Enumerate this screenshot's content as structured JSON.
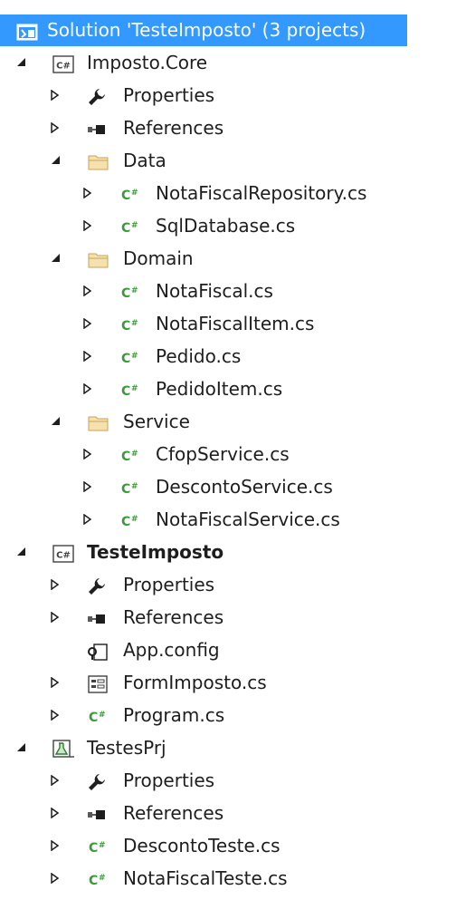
{
  "solution": {
    "label": "Solution 'TesteImposto' (3 projects)",
    "icon": "solution-icon"
  },
  "items": [
    {
      "name": "project-imposto-core",
      "label": "Imposto.Core",
      "level": 1,
      "icon": "csharp-project-icon",
      "expander": "expanded",
      "bold": false
    },
    {
      "name": "item-properties",
      "label": "Properties",
      "level": 2,
      "icon": "wrench-icon",
      "expander": "collapsed",
      "bold": false
    },
    {
      "name": "item-references",
      "label": "References",
      "level": 2,
      "icon": "references-icon",
      "expander": "collapsed",
      "bold": false
    },
    {
      "name": "folder-data",
      "label": "Data",
      "level": 2,
      "icon": "folder-icon",
      "expander": "expanded",
      "bold": false
    },
    {
      "name": "file-notafiscalrepository",
      "label": "NotaFiscalRepository.cs",
      "level": 3,
      "icon": "csharp-file-icon",
      "expander": "collapsed",
      "bold": false
    },
    {
      "name": "file-sqldatabase",
      "label": "SqlDatabase.cs",
      "level": 3,
      "icon": "csharp-file-icon",
      "expander": "collapsed",
      "bold": false
    },
    {
      "name": "folder-domain",
      "label": "Domain",
      "level": 2,
      "icon": "folder-icon",
      "expander": "expanded",
      "bold": false
    },
    {
      "name": "file-notafiscal",
      "label": "NotaFiscal.cs",
      "level": 3,
      "icon": "csharp-file-icon",
      "expander": "collapsed",
      "bold": false
    },
    {
      "name": "file-notafiscalitem",
      "label": "NotaFiscalItem.cs",
      "level": 3,
      "icon": "csharp-file-icon",
      "expander": "collapsed",
      "bold": false
    },
    {
      "name": "file-pedido",
      "label": "Pedido.cs",
      "level": 3,
      "icon": "csharp-file-icon",
      "expander": "collapsed",
      "bold": false
    },
    {
      "name": "file-pedidoitem",
      "label": "PedidoItem.cs",
      "level": 3,
      "icon": "csharp-file-icon",
      "expander": "collapsed",
      "bold": false
    },
    {
      "name": "folder-service",
      "label": "Service",
      "level": 2,
      "icon": "folder-icon",
      "expander": "expanded",
      "bold": false
    },
    {
      "name": "file-cfopservice",
      "label": "CfopService.cs",
      "level": 3,
      "icon": "csharp-file-icon",
      "expander": "collapsed",
      "bold": false
    },
    {
      "name": "file-descontoservice",
      "label": "DescontoService.cs",
      "level": 3,
      "icon": "csharp-file-icon",
      "expander": "collapsed",
      "bold": false
    },
    {
      "name": "file-notafiscalservice",
      "label": "NotaFiscalService.cs",
      "level": 3,
      "icon": "csharp-file-icon",
      "expander": "collapsed",
      "bold": false
    },
    {
      "name": "project-testeimposto",
      "label": "TesteImposto",
      "level": 1,
      "icon": "csharp-project-icon",
      "expander": "expanded",
      "bold": true
    },
    {
      "name": "item-properties",
      "label": "Properties",
      "level": 2,
      "icon": "wrench-icon",
      "expander": "collapsed",
      "bold": false
    },
    {
      "name": "item-references",
      "label": "References",
      "level": 2,
      "icon": "references-icon",
      "expander": "collapsed",
      "bold": false
    },
    {
      "name": "file-app-config",
      "label": "App.config",
      "level": 2,
      "icon": "config-icon",
      "expander": "none",
      "bold": false
    },
    {
      "name": "file-formimposto",
      "label": "FormImposto.cs",
      "level": 2,
      "icon": "form-icon",
      "expander": "collapsed",
      "bold": false
    },
    {
      "name": "file-program",
      "label": "Program.cs",
      "level": 2,
      "icon": "csharp-file-icon",
      "expander": "collapsed",
      "bold": false
    },
    {
      "name": "project-testesprj",
      "label": "TestesPrj",
      "level": 1,
      "icon": "test-project-icon",
      "expander": "expanded",
      "bold": false
    },
    {
      "name": "item-properties",
      "label": "Properties",
      "level": 2,
      "icon": "wrench-icon",
      "expander": "collapsed",
      "bold": false
    },
    {
      "name": "item-references",
      "label": "References",
      "level": 2,
      "icon": "references-icon",
      "expander": "collapsed",
      "bold": false
    },
    {
      "name": "file-descontoteste",
      "label": "DescontoTeste.cs",
      "level": 2,
      "icon": "csharp-file-icon",
      "expander": "collapsed",
      "bold": false
    },
    {
      "name": "file-notafiscalteste",
      "label": "NotaFiscalTeste.cs",
      "level": 2,
      "icon": "csharp-file-icon",
      "expander": "collapsed",
      "bold": false
    }
  ],
  "colors": {
    "selection": "#3399ff",
    "csharp_green": "#3a9b3a",
    "folder": "#dcb67a",
    "text": "#1e1e1e"
  }
}
